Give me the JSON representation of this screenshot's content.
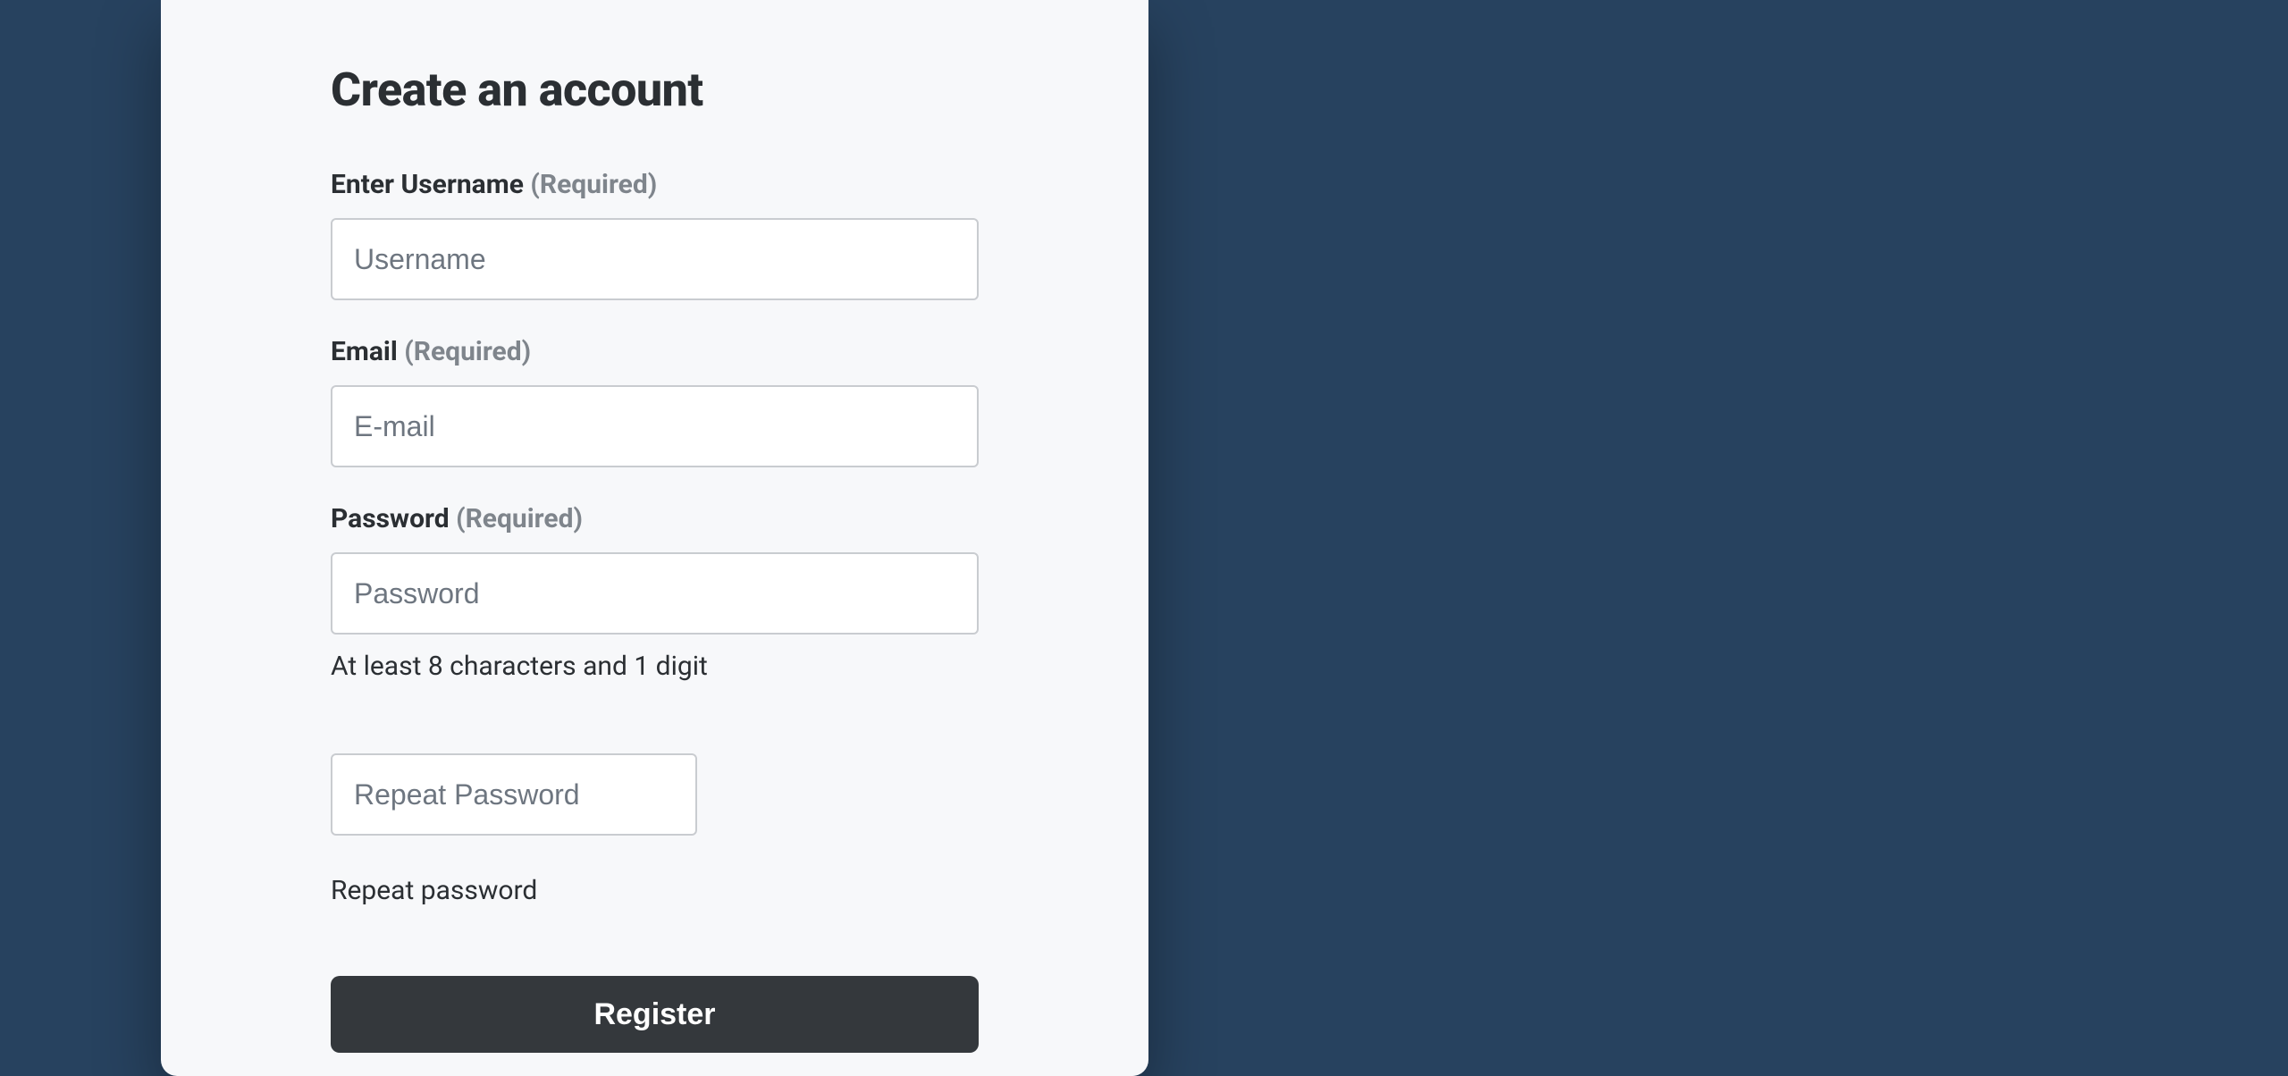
{
  "title": "Create an account",
  "fields": {
    "username": {
      "label": "Enter Username",
      "required_text": "(Required)",
      "placeholder": "Username"
    },
    "email": {
      "label": "Email",
      "required_text": "(Required)",
      "placeholder": "E-mail"
    },
    "password": {
      "label": "Password",
      "required_text": "(Required)",
      "placeholder": "Password",
      "hint": "At least 8 characters and 1 digit"
    },
    "repeat_password": {
      "placeholder": "Repeat Password",
      "hint": "Repeat password"
    }
  },
  "submit_label": "Register"
}
